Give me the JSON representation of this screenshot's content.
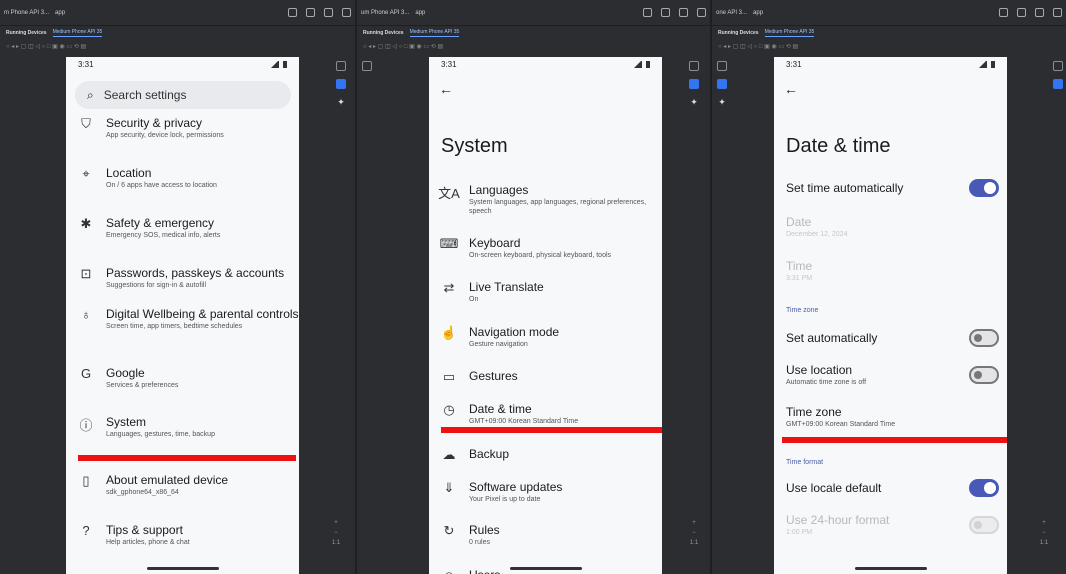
{
  "ide": {
    "device_dropdowns": [
      "m Phone API 3...",
      "um Phone API 3...",
      "one API 3..."
    ],
    "app_selector": "app",
    "running_devices_label": "Running Devices",
    "device_tab": "Medium Phone API 35",
    "zoom_label": "1:1"
  },
  "panels": [
    {
      "status_time": "3:31",
      "search_placeholder": "Search settings",
      "items": [
        {
          "icon": "shield-icon",
          "glyph": "⛉",
          "title": "Security & privacy",
          "subtitle": "App security, device lock, permissions"
        },
        {
          "icon": "location-pin-icon",
          "glyph": "⌖",
          "title": "Location",
          "subtitle": "On / 6 apps have access to location"
        },
        {
          "icon": "emergency-asterisk-icon",
          "glyph": "✱",
          "title": "Safety & emergency",
          "subtitle": "Emergency SOS, medical info, alerts"
        },
        {
          "icon": "account-box-icon",
          "glyph": "⊡",
          "title": "Passwords, passkeys & accounts",
          "subtitle": "Suggestions for sign-in & autofill"
        },
        {
          "icon": "wellbeing-icon",
          "glyph": "♁",
          "title": "Digital Wellbeing & parental controls",
          "subtitle": "Screen time, app timers, bedtime schedules"
        },
        {
          "icon": "google-g-icon",
          "glyph": "G",
          "title": "Google",
          "subtitle": "Services & preferences"
        },
        {
          "icon": "info-circle-icon",
          "glyph": "ⓘ",
          "title": "System",
          "subtitle": "Languages, gestures, time, backup"
        },
        {
          "icon": "phone-info-icon",
          "glyph": "▯",
          "title": "About emulated device",
          "subtitle": "sdk_gphone64_x86_64"
        },
        {
          "icon": "help-circle-icon",
          "glyph": "?",
          "title": "Tips & support",
          "subtitle": "Help articles, phone & chat"
        }
      ]
    },
    {
      "status_time": "3:31",
      "page_title": "System",
      "items": [
        {
          "icon": "translate-icon",
          "glyph": "文A",
          "title": "Languages",
          "subtitle": "System languages, app languages, regional preferences, speech"
        },
        {
          "icon": "keyboard-icon",
          "glyph": "⌨",
          "title": "Keyboard",
          "subtitle": "On-screen keyboard, physical keyboard, tools"
        },
        {
          "icon": "live-translate-icon",
          "glyph": "⇄",
          "title": "Live Translate",
          "subtitle": "On"
        },
        {
          "icon": "gesture-hand-icon",
          "glyph": "☝",
          "title": "Navigation mode",
          "subtitle": "Gesture navigation"
        },
        {
          "icon": "gestures-phone-icon",
          "glyph": "▭",
          "title": "Gestures",
          "subtitle": ""
        },
        {
          "icon": "clock-icon",
          "glyph": "◷",
          "title": "Date & time",
          "subtitle": "GMT+09:00 Korean Standard Time"
        },
        {
          "icon": "cloud-backup-icon",
          "glyph": "☁",
          "title": "Backup",
          "subtitle": ""
        },
        {
          "icon": "system-update-icon",
          "glyph": "⇓",
          "title": "Software updates",
          "subtitle": "Your Pixel is up to date"
        },
        {
          "icon": "rules-icon",
          "glyph": "↻",
          "title": "Rules",
          "subtitle": "0 rules"
        },
        {
          "icon": "users-icon",
          "glyph": "☺",
          "title": "Users",
          "subtitle": ""
        }
      ]
    },
    {
      "status_time": "3:31",
      "page_title": "Date & time",
      "rows": [
        {
          "title": "Set time automatically",
          "subtitle": "",
          "toggle": "on",
          "disabled": false
        },
        {
          "title": "Date",
          "subtitle": "December 12, 2024",
          "toggle": "",
          "disabled": true
        },
        {
          "title": "Time",
          "subtitle": "3:31 PM",
          "toggle": "",
          "disabled": true
        },
        {
          "section": "Time zone"
        },
        {
          "title": "Set automatically",
          "subtitle": "",
          "toggle": "off",
          "disabled": false
        },
        {
          "title": "Use location",
          "subtitle": "Automatic time zone is off",
          "toggle": "off",
          "disabled": false
        },
        {
          "title": "Time zone",
          "subtitle": "GMT+09:00 Korean Standard Time",
          "toggle": "",
          "disabled": false
        },
        {
          "section": "Time format"
        },
        {
          "title": "Use locale default",
          "subtitle": "",
          "toggle": "on",
          "disabled": false
        },
        {
          "title": "Use 24-hour format",
          "subtitle": "1:00 PM",
          "toggle": "disabled",
          "disabled": true
        }
      ]
    }
  ],
  "colors": {
    "highlight_red": "#ee1111",
    "toggle_on": "#4859b8",
    "ide_bg": "#2b2d30",
    "accent_blue": "#3574f0"
  }
}
